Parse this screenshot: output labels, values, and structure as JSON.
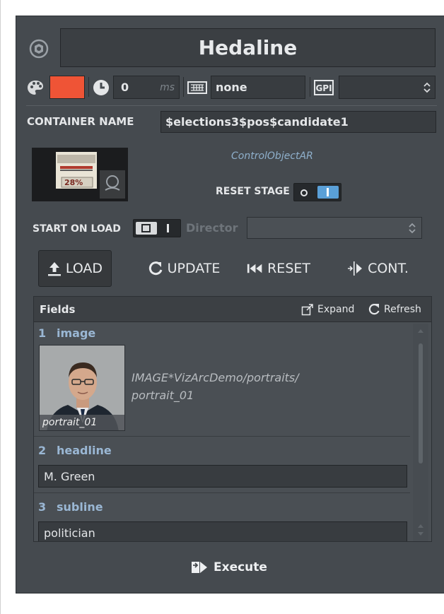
{
  "header": {
    "title": "Hedaline"
  },
  "toolbar": {
    "color_hex": "#ef5436",
    "delay_value": "0",
    "delay_unit": "ms",
    "keyboard_value": "none",
    "gpi_value": ""
  },
  "container": {
    "label": "CONTAINER NAME",
    "value": "$elections3$pos$candidate1"
  },
  "preview": {
    "control_object": "ControlObjectAR",
    "reset_stage_label": "RESET STAGE",
    "thumb_text": "28%"
  },
  "start_on_load": {
    "label": "START ON LOAD",
    "director_label": "Director",
    "director_value": ""
  },
  "actions": {
    "load": "LOAD",
    "update": "UPDATE",
    "reset": "RESET",
    "cont": "CONT."
  },
  "fields": {
    "title": "Fields",
    "expand": "Expand",
    "refresh": "Refresh",
    "items": [
      {
        "num": "1",
        "name": "image",
        "caption": "portrait_01",
        "path": "IMAGE*VizArcDemo/portraits/portrait_01"
      },
      {
        "num": "2",
        "name": "headline",
        "value": "M. Green"
      },
      {
        "num": "3",
        "name": "subline",
        "value": "politician"
      }
    ]
  },
  "execute": {
    "label": "Execute"
  }
}
